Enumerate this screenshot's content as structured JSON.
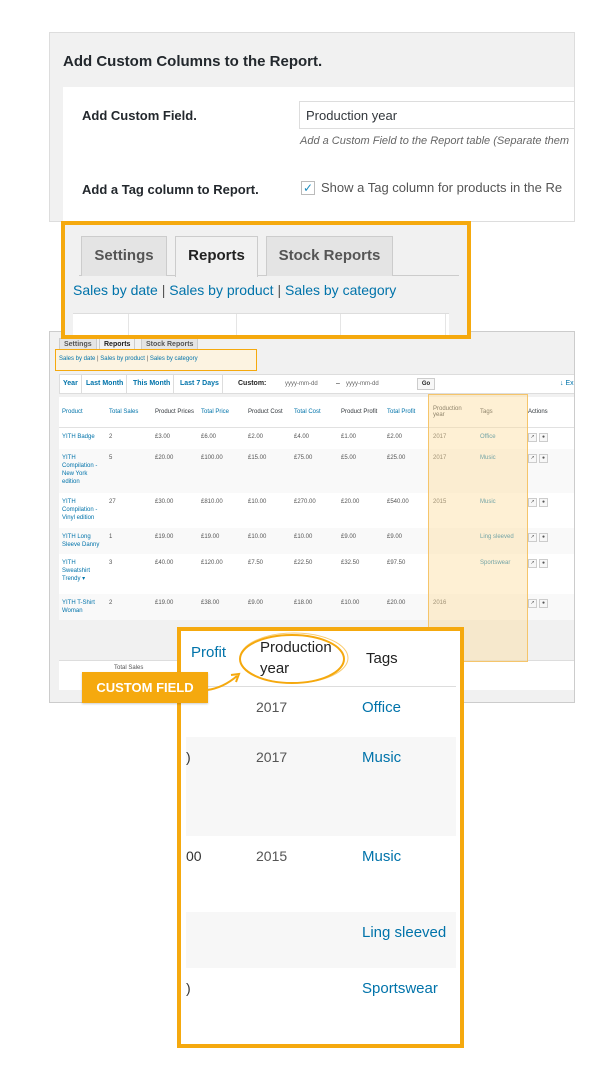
{
  "settings_panel": {
    "title": "Add Custom Columns to the Report.",
    "custom_field_label": "Add Custom Field.",
    "custom_field_value": "Production year",
    "custom_field_hint": "Add a Custom Field to the Report table (Separate them",
    "tag_column_label": "Add a Tag column to Report.",
    "tag_checkbox_checked": "✓",
    "tag_checkbox_label": "Show a Tag column for products in the Re"
  },
  "tabs_panel": {
    "tabs": [
      "Settings",
      "Reports",
      "Stock Reports"
    ],
    "active_tab": "Reports",
    "sub_links": [
      "Sales by date",
      "Sales by product",
      "Sales by category"
    ],
    "separator": "|"
  },
  "report_panel": {
    "tabs": [
      "Settings",
      "Reports",
      "Stock Reports"
    ],
    "sub_links": [
      "Sales by date",
      "Sales by product",
      "Sales by category"
    ],
    "separator": "|",
    "ranges": [
      "Year",
      "Last Month",
      "This Month",
      "Last 7 Days"
    ],
    "custom_label": "Custom:",
    "date_placeholder_1": "yyyy-mm-dd",
    "date_dash": "–",
    "date_placeholder_2": "yyyy-mm-dd",
    "go_label": "Go",
    "export_label": "↓ Ex",
    "columns": [
      "Product",
      "Total Sales",
      "Product Prices",
      "Total Price",
      "Product Cost",
      "Total Cost",
      "Product Profit",
      "Total Profit",
      "Production year",
      "Tags",
      "Actions"
    ],
    "rows": [
      {
        "product": "YITH Badge",
        "sales": "2",
        "prices": "£3.00",
        "total_price": "£6.00",
        "cost": "£2.00",
        "total_cost": "£4.00",
        "profit": "£1.00",
        "total_profit": "£2.00",
        "year": "2017",
        "tags": "Office"
      },
      {
        "product": "YITH Compilation - New York edition",
        "sales": "5",
        "prices": "£20.00",
        "total_price": "£100.00",
        "cost": "£15.00",
        "total_cost": "£75.00",
        "profit": "£5.00",
        "total_profit": "£25.00",
        "year": "2017",
        "tags": "Music"
      },
      {
        "product": "YITH Compilation - Vinyl edition",
        "sales": "27",
        "prices": "£30.00",
        "total_price": "£810.00",
        "cost": "£10.00",
        "total_cost": "£270.00",
        "profit": "£20.00",
        "total_profit": "£540.00",
        "year": "2015",
        "tags": "Music"
      },
      {
        "product": "YITH Long Sleeve Danny",
        "sales": "1",
        "prices": "£19.00",
        "total_price": "£19.00",
        "cost": "£10.00",
        "total_cost": "£10.00",
        "profit": "£9.00",
        "total_profit": "£9.00",
        "year": "",
        "tags": "Ling sleeved"
      },
      {
        "product": "YITH Sweatshirt Trendy ▾",
        "sales": "3",
        "prices": "£40.00",
        "total_price": "£120.00",
        "cost": "£7.50",
        "total_cost": "£22.50",
        "profit": "£32.50",
        "total_profit": "£97.50",
        "year": "",
        "tags": "Sportswear"
      },
      {
        "product": "YITH T-Shirt Woman",
        "sales": "2",
        "prices": "£19.00",
        "total_price": "£38.00",
        "cost": "£9.00",
        "total_cost": "£18.00",
        "profit": "£10.00",
        "total_profit": "£20.00",
        "year": "2016",
        "tags": ""
      }
    ],
    "footer_total_label": "Total Sales"
  },
  "badge": {
    "label": "CUSTOM FIELD"
  },
  "zoom_panel": {
    "header_profit": "Profit",
    "header_year": "Production year",
    "header_tags": "Tags",
    "rows": [
      {
        "profit": "",
        "year": "2017",
        "tags": "Office"
      },
      {
        "profit": ")",
        "year": "2017",
        "tags": "Music"
      },
      {
        "profit": "00",
        "year": "2015",
        "tags": "Music"
      },
      {
        "profit": "",
        "year": "",
        "tags": "Ling sleeved"
      },
      {
        "profit": ")",
        "year": "",
        "tags": "Sportswear"
      }
    ]
  },
  "colors": {
    "accent": "#f5a90e",
    "link": "#0073aa",
    "background": "#f1f1f1"
  }
}
